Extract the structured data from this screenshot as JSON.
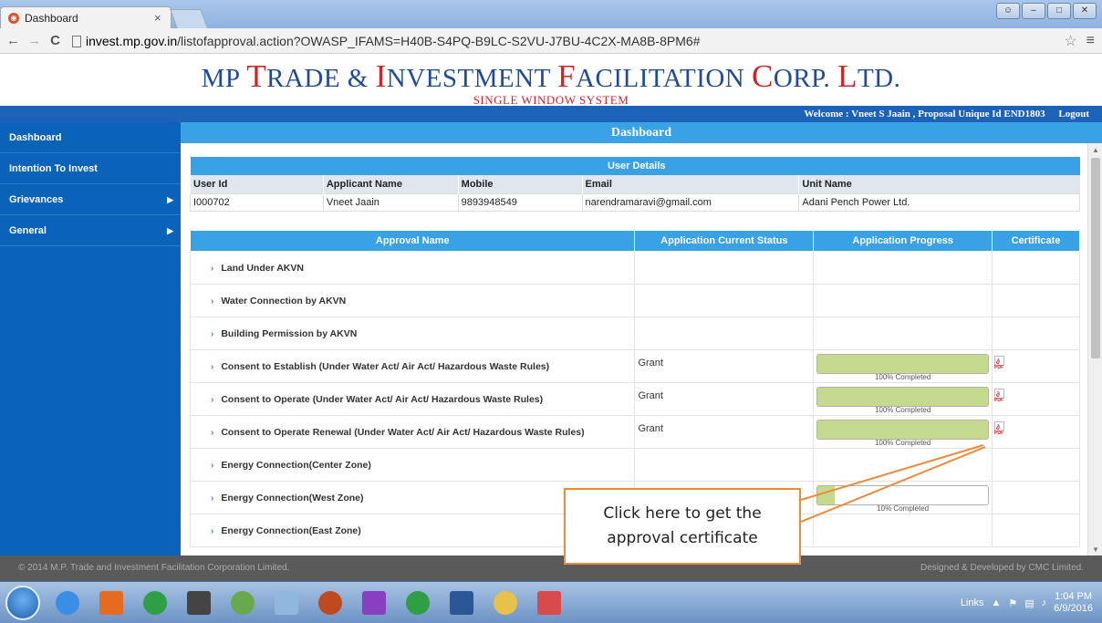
{
  "browser": {
    "tab_title": "Dashboard",
    "tab_close": "×",
    "url_host": "invest.mp.gov.in",
    "url_path": "/listofapproval.action?OWASP_IFAMS=H40B-S4PQ-B9LC-S2VU-J7BU-4C2X-MA8B-8PM6#",
    "back": "←",
    "forward": "→",
    "reload": "C",
    "star": "☆",
    "menu": "≡"
  },
  "site": {
    "title_parts": [
      {
        "text": "MP ",
        "big": false
      },
      {
        "text": "T",
        "big": true
      },
      {
        "text": "RADE & ",
        "big": false
      },
      {
        "text": "I",
        "big": true
      },
      {
        "text": "NVESTMENT ",
        "big": false
      },
      {
        "text": "F",
        "big": true
      },
      {
        "text": "ACILITATION ",
        "big": false
      },
      {
        "text": "C",
        "big": true
      },
      {
        "text": "ORP. ",
        "big": false
      },
      {
        "text": "L",
        "big": true
      },
      {
        "text": "TD.",
        "big": false
      }
    ],
    "subtitle": "SINGLE WINDOW SYSTEM",
    "welcome": "Welcome : Vneet S Jaain , Proposal Unique Id END1803",
    "logout": "Logout"
  },
  "sidebar": {
    "items": [
      {
        "label": "Dashboard",
        "has_arrow": false
      },
      {
        "label": "Intention To Invest",
        "has_arrow": false
      },
      {
        "label": "Grievances",
        "has_arrow": true
      },
      {
        "label": "General",
        "has_arrow": true
      }
    ]
  },
  "main": {
    "heading": "Dashboard",
    "user_details": {
      "caption": "User Details",
      "headers": [
        "User Id",
        "Applicant Name",
        "Mobile",
        "Email",
        "Unit Name"
      ],
      "row": [
        "I000702",
        "Vneet Jaain",
        "9893948549",
        "narendramaravi@gmail.com",
        "Adani Pench Power Ltd."
      ]
    },
    "approvals": {
      "headers": [
        "Approval Name",
        "Application Current Status",
        "Application Progress",
        "Certificate"
      ],
      "rows": [
        {
          "name": "Land Under AKVN",
          "status": "",
          "progress": null,
          "progress_label": "",
          "certificate": false
        },
        {
          "name": "Water Connection by AKVN",
          "status": "",
          "progress": null,
          "progress_label": "",
          "certificate": false
        },
        {
          "name": "Building Permission by AKVN",
          "status": "",
          "progress": null,
          "progress_label": "",
          "certificate": false
        },
        {
          "name": "Consent to Establish (Under Water Act/ Air Act/ Hazardous Waste Rules)",
          "status": "Grant",
          "progress": 100,
          "progress_label": "100% Completed",
          "certificate": true
        },
        {
          "name": "Consent to Operate (Under Water Act/ Air Act/ Hazardous Waste Rules)",
          "status": "Grant",
          "progress": 100,
          "progress_label": "100% Completed",
          "certificate": true
        },
        {
          "name": "Consent to Operate Renewal (Under Water Act/ Air Act/ Hazardous Waste Rules)",
          "status": "Grant",
          "progress": 100,
          "progress_label": "100% Completed",
          "certificate": true
        },
        {
          "name": "Energy Connection(Center Zone)",
          "status": "",
          "progress": null,
          "progress_label": "",
          "certificate": false
        },
        {
          "name": "Energy Connection(West Zone)",
          "status": "",
          "progress": 10,
          "progress_label": "10% Completed",
          "certificate": false
        },
        {
          "name": "Energy Connection(East Zone)",
          "status": "",
          "progress": null,
          "progress_label": "",
          "certificate": false
        }
      ]
    }
  },
  "callout": {
    "line1": "Click here to get the",
    "line2": "approval certificate"
  },
  "footer": {
    "left": "© 2014 M.P. Trade and Investment Facilitation Corporation Limited.",
    "right": "Designed & Developed by CMC Limited."
  },
  "taskbar": {
    "links_label": "Links",
    "time": "1:04 PM",
    "date": "6/9/2016",
    "icons": [
      {
        "name": "ie-icon",
        "color": "#3a8ee6"
      },
      {
        "name": "firefox-icon",
        "color": "#e66a1f"
      },
      {
        "name": "chrome-icon",
        "color": "#2f9e45"
      },
      {
        "name": "media-icon",
        "color": "#444444"
      },
      {
        "name": "notepad-icon",
        "color": "#6aa84f"
      },
      {
        "name": "paint-icon",
        "color": "#8fb7e0"
      },
      {
        "name": "java-icon",
        "color": "#c04a1f"
      },
      {
        "name": "colors-icon",
        "color": "#8a3fc0"
      },
      {
        "name": "chrome2-icon",
        "color": "#2f9e45"
      },
      {
        "name": "word-icon",
        "color": "#2b5797"
      },
      {
        "name": "folder-icon",
        "color": "#e8c14a"
      },
      {
        "name": "chart-app-icon",
        "color": "#d94a4a"
      }
    ]
  }
}
